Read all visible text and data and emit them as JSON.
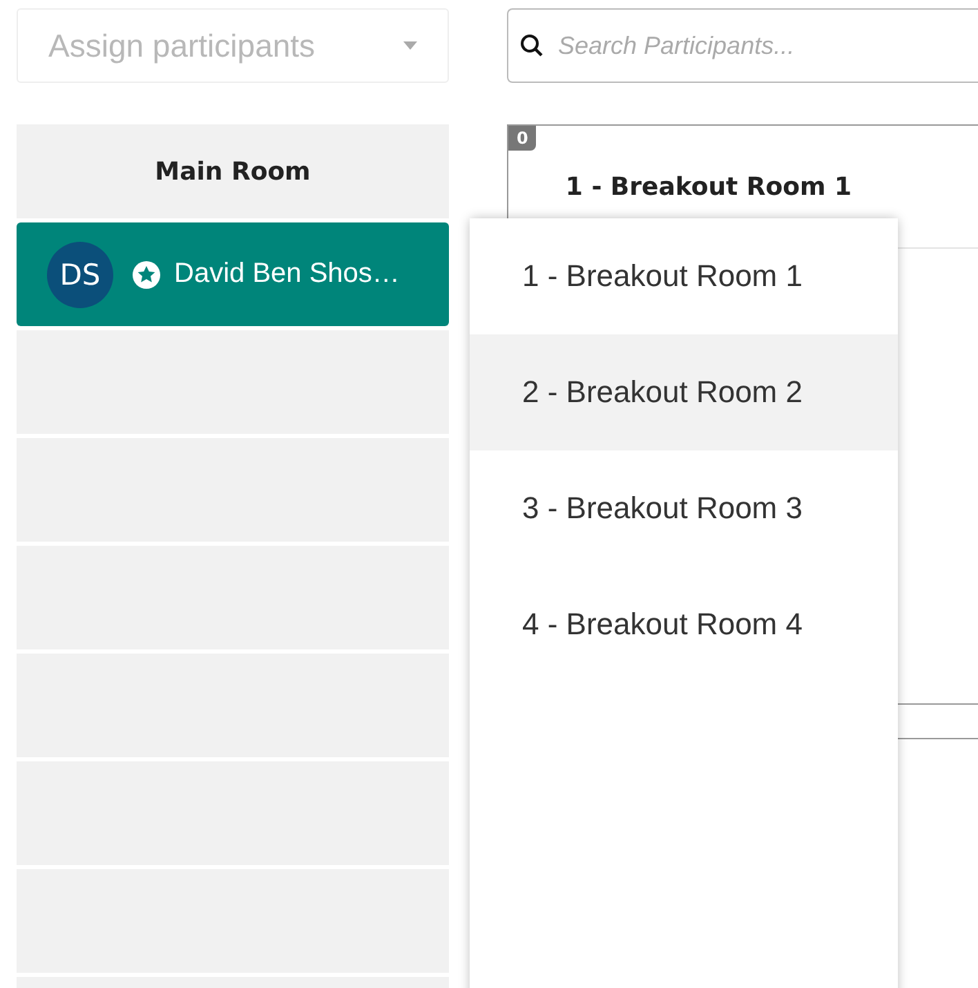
{
  "assign_dropdown": {
    "label": "Assign participants",
    "disabled": true
  },
  "search": {
    "placeholder": "Search Participants..."
  },
  "main_room": {
    "title": "Main Room",
    "participants": [
      {
        "initials": "DS",
        "name": "David Ben Shos…",
        "host": true,
        "selected": true
      }
    ]
  },
  "breakout_rooms": [
    {
      "count": "0",
      "title": "1 - Breakout Room 1"
    }
  ],
  "room_menu": {
    "items": [
      {
        "label": "1 - Breakout Room 1",
        "selected": false
      },
      {
        "label": "2 - Breakout Room 2",
        "selected": true
      },
      {
        "label": "3 - Breakout Room 3",
        "selected": false
      },
      {
        "label": "4 - Breakout Room 4",
        "selected": false
      }
    ]
  }
}
